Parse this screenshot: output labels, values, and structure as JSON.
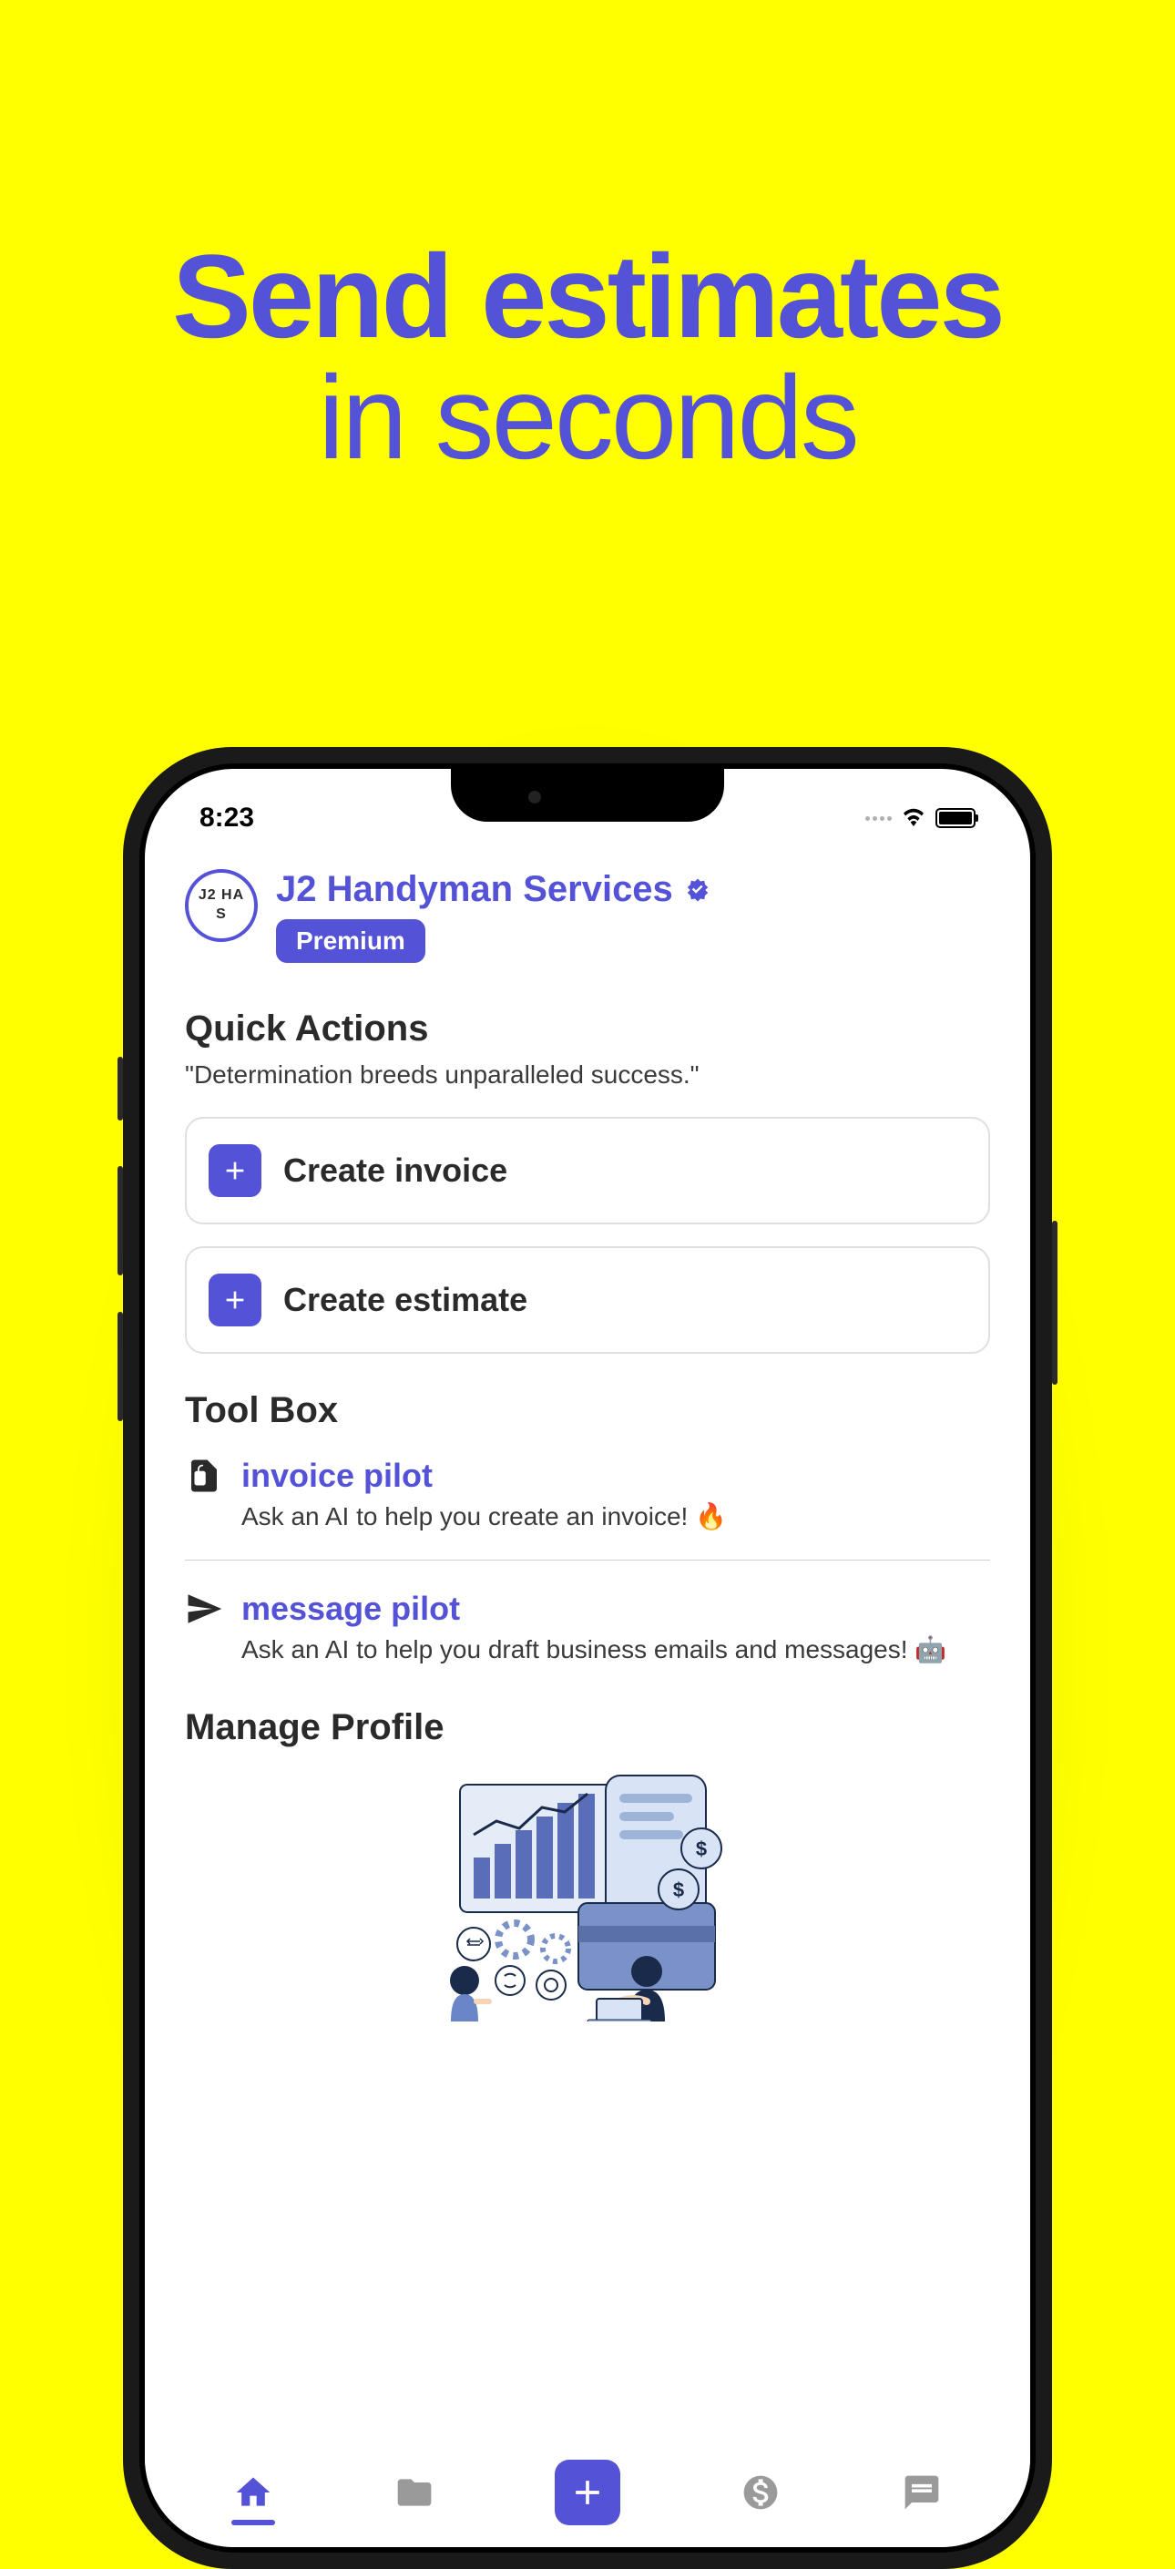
{
  "headline": {
    "line1": "Send estimates",
    "line2": "in seconds"
  },
  "status_bar": {
    "time": "8:23"
  },
  "profile": {
    "avatar_text": "J2 HA S",
    "name": "J2 Handyman Services",
    "badge_label": "Premium"
  },
  "quick_actions": {
    "title": "Quick Actions",
    "quote": "\"Determination breeds unparalleled success.\"",
    "items": [
      {
        "label": "Create invoice"
      },
      {
        "label": "Create estimate"
      }
    ]
  },
  "toolbox": {
    "title": "Tool Box",
    "items": [
      {
        "name": "invoice pilot",
        "description": "Ask an AI to help you create an invoice! 🔥"
      },
      {
        "name": "message pilot",
        "description": "Ask an AI to help you draft business emails and messages! 🤖"
      }
    ]
  },
  "manage_profile": {
    "title": "Manage Profile"
  },
  "colors": {
    "accent": "#5452D6",
    "background": "#FFFF00"
  }
}
